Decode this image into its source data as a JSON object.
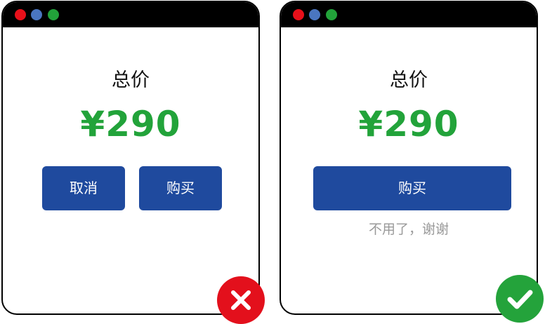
{
  "colors": {
    "button_blue": "#1f4a9e",
    "price_green": "#22a33a",
    "decline_gray": "#999999",
    "badge_wrong": "#e3101c",
    "badge_right": "#24a33b",
    "traffic_red": "#e8101a",
    "traffic_blue": "#4a76c0",
    "traffic_green": "#22a33a"
  },
  "bad_example": {
    "total_label": "总价",
    "price": "¥290",
    "cancel_label": "取消",
    "buy_label": "购买",
    "badge_icon": "x-icon"
  },
  "good_example": {
    "total_label": "总价",
    "price": "¥290",
    "buy_label": "购买",
    "decline_label": "不用了，谢谢",
    "badge_icon": "checkmark-icon"
  }
}
